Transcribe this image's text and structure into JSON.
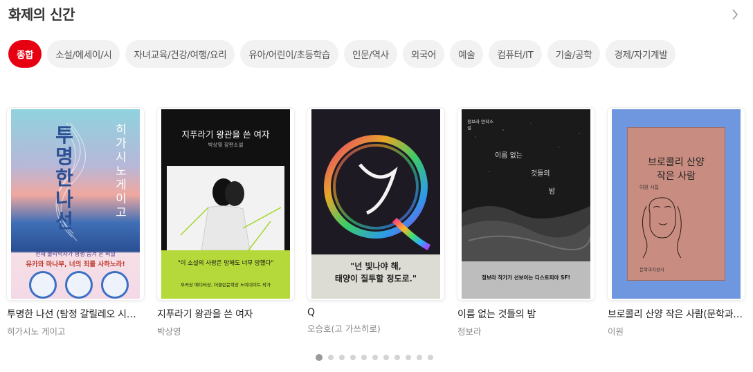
{
  "section": {
    "title": "화제의 신간"
  },
  "chips": [
    {
      "label": "종합",
      "active": true
    },
    {
      "label": "소설/에세이/시",
      "active": false
    },
    {
      "label": "자녀교육/건강/여행/요리",
      "active": false
    },
    {
      "label": "유아/어린이/초등학습",
      "active": false
    },
    {
      "label": "인문/역사",
      "active": false
    },
    {
      "label": "외국어",
      "active": false
    },
    {
      "label": "예술",
      "active": false
    },
    {
      "label": "컴퓨터/IT",
      "active": false
    },
    {
      "label": "기술/공학",
      "active": false
    },
    {
      "label": "경제/자기계발",
      "active": false
    }
  ],
  "books": [
    {
      "title": "투명한 나선 (탐정 갈릴레오 시리즈)",
      "author": "히가시노 게이고",
      "cover": {
        "title": "투명한 나선",
        "author": "히가시노 게이고",
        "tagline1": "천재 물리학자가 평생 숨겨 온 비밀",
        "tagline2": "유카와 마나부, 너의 죄를 사하노라!"
      }
    },
    {
      "title": "지푸라기 왕관을 쓴 여자",
      "author": "박상영",
      "cover": {
        "title": "지푸라기 왕관을 쓴 여자",
        "subtitle": "박상영 장편소설",
        "quote": "\"이 소설의 사랑은 망해도 너무 망했다\"",
        "blurb": "부커상 에디터상, 더블린문학상 노미네이트 작가"
      }
    },
    {
      "title": "Q",
      "author": "오승호(고 가쓰히로)",
      "cover": {
        "quote1": "\"넌 빛나야 해,",
        "quote2": "태양이 질투할 정도로.\""
      }
    },
    {
      "title": "이름 없는 것들의 밤",
      "author": "정보라",
      "cover": {
        "corner": "정보라 연작소설",
        "title1": "이름 없는",
        "title2": "것들의",
        "title3": "밤",
        "tagline": "정보라 작가가 선보이는 디스토피아 SF!"
      }
    },
    {
      "title": "브로콜리 산양 작은 사람(문학과지성 시인선)",
      "author": "이원",
      "cover": {
        "title1": "브로콜리 산양",
        "title2": "작은 사람",
        "poet": "이원 시집",
        "publisher": "문학과지성사"
      }
    }
  ],
  "pager": {
    "count": 11,
    "active_index": 0
  },
  "colors": {
    "accent": "#e60012",
    "chip_bg": "#f2f2f2",
    "dot_active": "#9a9a9a",
    "dot_inactive": "#d4d4d4"
  },
  "icons": {
    "more": "chevron-right-icon"
  }
}
